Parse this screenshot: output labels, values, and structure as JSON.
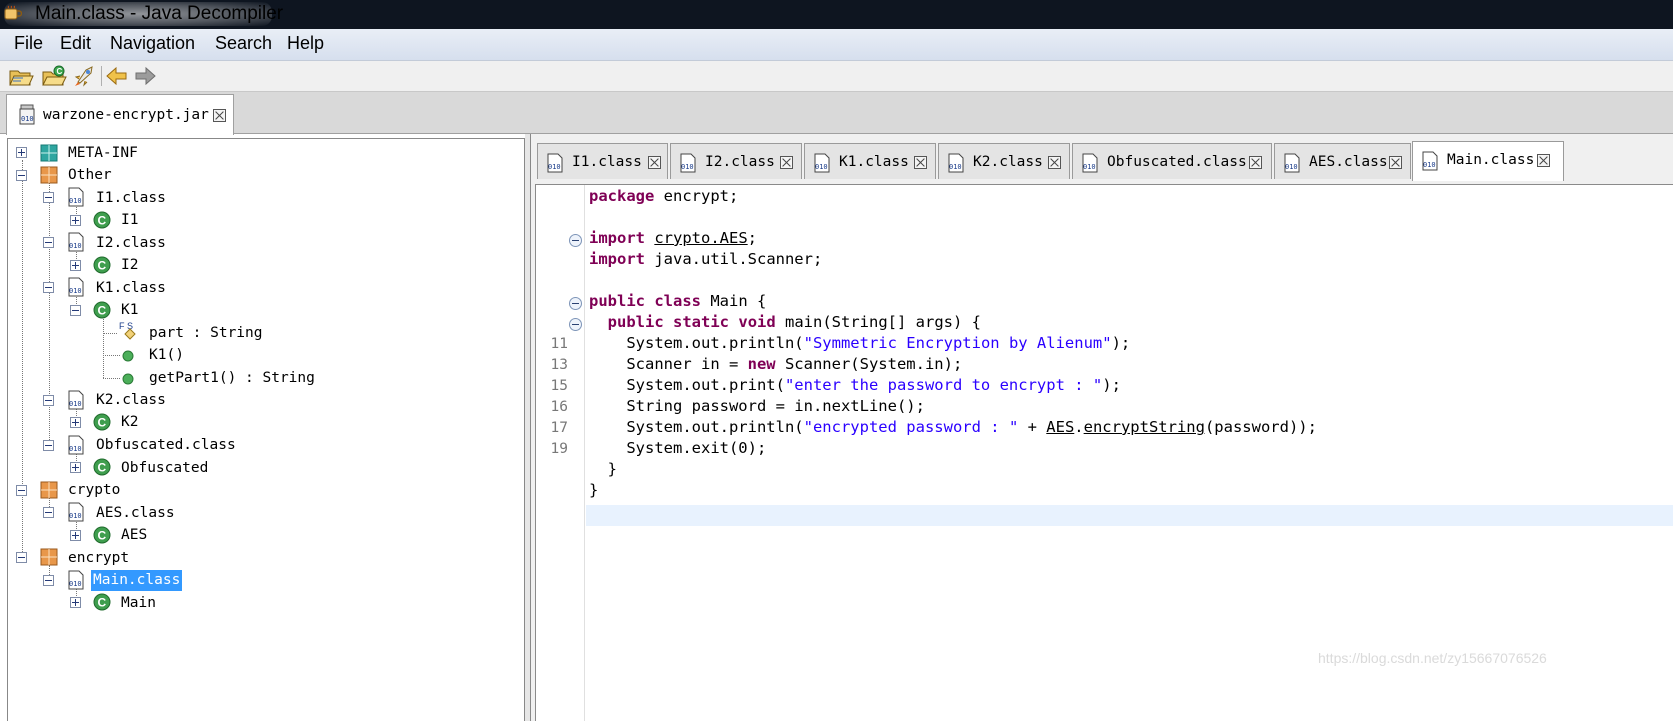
{
  "window": {
    "title": "Main.class - Java Decompiler",
    "icon": "coffee-cup-icon"
  },
  "menu": [
    "File",
    "Edit",
    "Navigation",
    "Search",
    "Help"
  ],
  "toolbar": {
    "buttons": [
      "open-file-icon",
      "open-type-icon",
      "search-rocket-icon",
      "back-arrow-icon",
      "forward-arrow-icon"
    ]
  },
  "file_tab": {
    "label": "warzone-encrypt.jar",
    "icon": "jar-icon"
  },
  "tree": {
    "meta_inf": "META-INF",
    "other": "Other",
    "i1_class": "I1.class",
    "i1": "I1",
    "i2_class": "I2.class",
    "i2": "I2",
    "k1_class": "K1.class",
    "k1": "K1",
    "k1_field": "part : String",
    "k1_ctor": "K1()",
    "k1_method": "getPart1() : String",
    "k2_class": "K2.class",
    "k2": "K2",
    "obf_class": "Obfuscated.class",
    "obf": "Obfuscated",
    "crypto": "crypto",
    "aes_class": "AES.class",
    "aes": "AES",
    "encrypt": "encrypt",
    "main_class": "Main.class",
    "main": "Main",
    "field_modifiers": "F S"
  },
  "class_tabs": [
    "I1.class",
    "I2.class",
    "K1.class",
    "K2.class",
    "Obfuscated.class",
    "AES.class",
    "Main.class"
  ],
  "active_tab": "Main.class",
  "editor": {
    "line_numbers": [
      "11",
      "13",
      "15",
      "16",
      "17",
      "19"
    ],
    "code": {
      "l1_kw": "package",
      "l1_rest": " encrypt;",
      "l2_kw": "import",
      "l2_sp": " ",
      "l2_ref": "crypto.AES",
      "l2_end": ";",
      "l3_kw": "import",
      "l3_rest": " java.util.Scanner;",
      "l4_kw1": "public",
      "l4_sp": " ",
      "l4_kw2": "class",
      "l4_rest": " Main {",
      "l5_indent": "  ",
      "l5_kw1": "public",
      "l5_sp1": " ",
      "l5_kw2": "static",
      "l5_sp2": " ",
      "l5_kw3": "void",
      "l5_rest": " main(String[] args) {",
      "l6_pre": "    System.out.println(",
      "l6_str": "\"Symmetric Encryption by Alienum\"",
      "l6_end": ");",
      "l7_pre": "    Scanner in = ",
      "l7_kw": "new",
      "l7_rest": " Scanner(System.in);",
      "l8_pre": "    System.out.print(",
      "l8_str": "\"enter the password to encrypt : \"",
      "l8_end": ");",
      "l9": "    String password = in.nextLine();",
      "l10_pre": "    System.out.println(",
      "l10_str": "\"encrypted password : \"",
      "l10_mid": " + ",
      "l10_ref1": "AES",
      "l10_dot": ".",
      "l10_ref2": "encryptString",
      "l10_end": "(password));",
      "l11": "    System.exit(0);",
      "l12": "  }",
      "l13": "}"
    }
  },
  "watermark": "https://blog.csdn.net/zy15667076526",
  "colors": {
    "keyword": "#7f0055",
    "string": "#2a00ff",
    "selection": "#3399ff",
    "current_line": "#e8f2fe"
  }
}
